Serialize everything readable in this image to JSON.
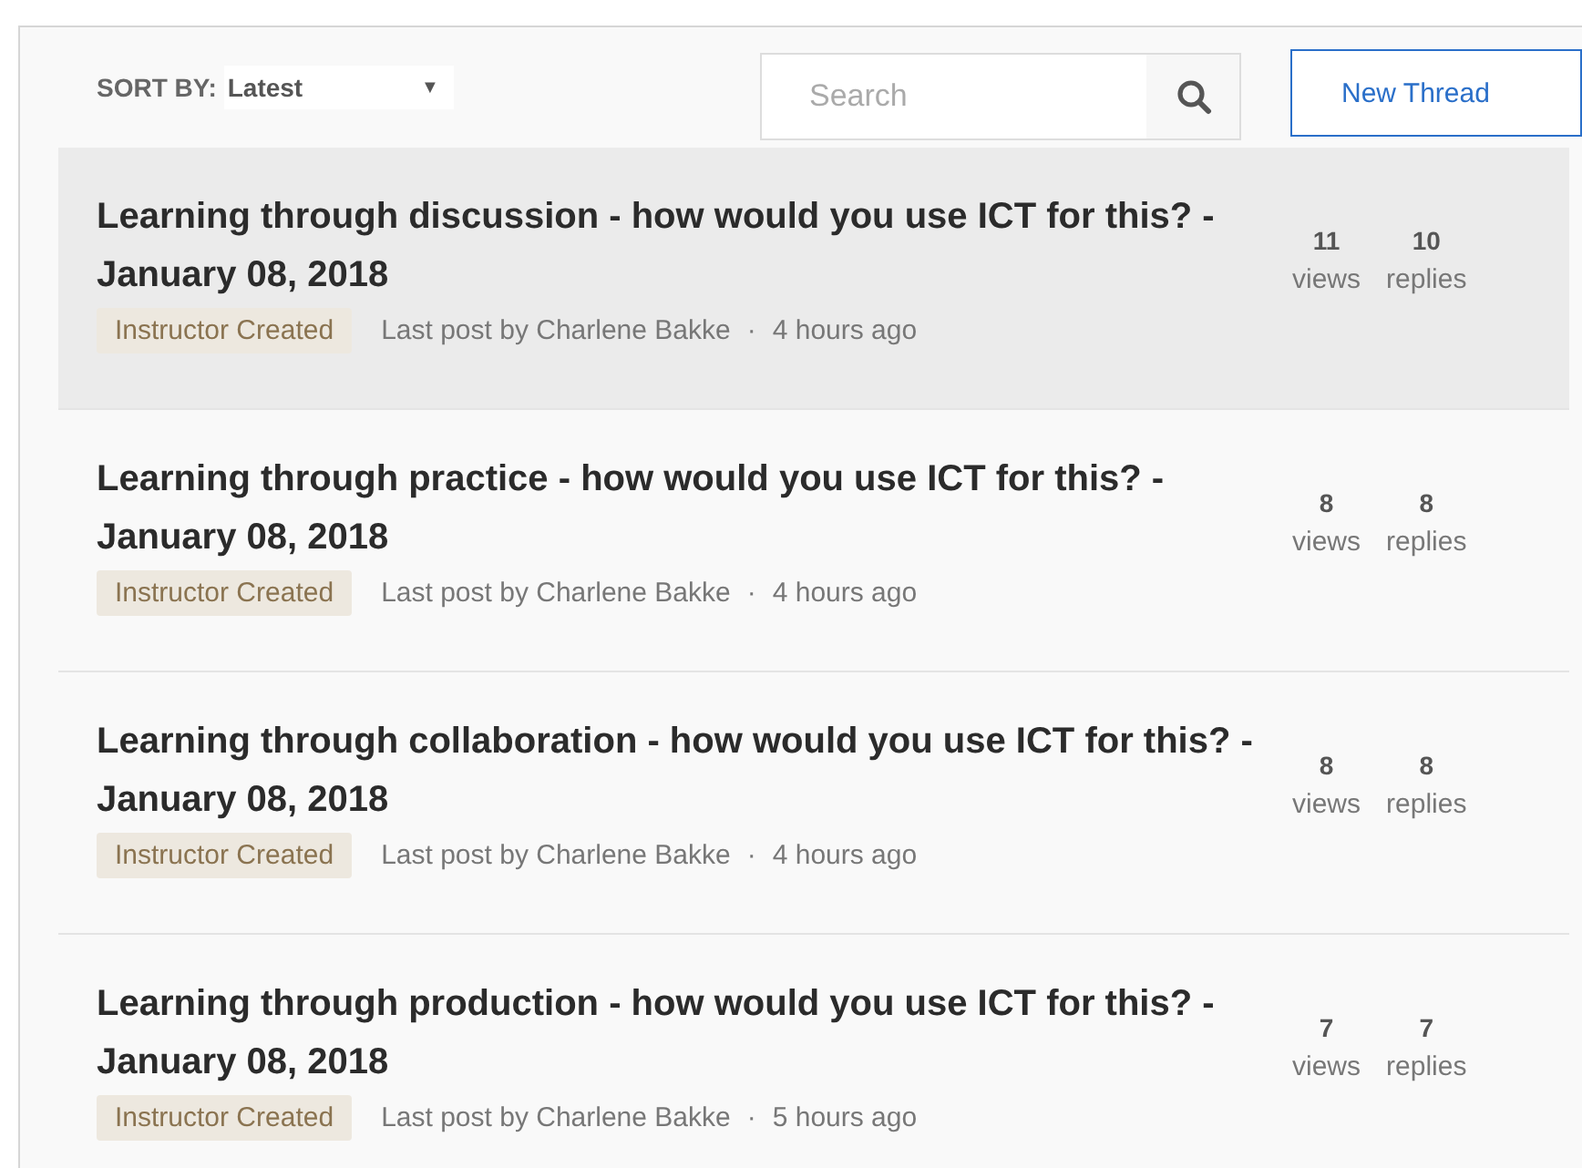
{
  "toolbar": {
    "sort_label": "SORT BY:",
    "sort_value": "Latest",
    "sort_caret": "▼",
    "search": {
      "placeholder": "Search"
    },
    "new_thread_button": "New Thread"
  },
  "threads": [
    {
      "title": "Learning through discussion - how would you use ICT for this? - January 08, 2018",
      "tag": "Instructor Created",
      "last_post": "Last post by Charlene Bakke",
      "separator": "·",
      "time": "4 hours ago",
      "views": "11",
      "views_label": "views",
      "replies": "10",
      "replies_label": "replies",
      "selected": true
    },
    {
      "title": "Learning through practice - how would you use ICT for this? - January 08, 2018",
      "tag": "Instructor Created",
      "last_post": "Last post by Charlene Bakke",
      "separator": "·",
      "time": "4 hours ago",
      "views": "8",
      "views_label": "views",
      "replies": "8",
      "replies_label": "replies",
      "selected": false
    },
    {
      "title": "Learning through collaboration - how would you use ICT for this? - January 08, 2018",
      "tag": "Instructor Created",
      "last_post": "Last post by Charlene Bakke",
      "separator": "·",
      "time": "4 hours ago",
      "views": "8",
      "views_label": "views",
      "replies": "8",
      "replies_label": "replies",
      "selected": false
    },
    {
      "title": "Learning through production - how would you use ICT for this? - January 08, 2018",
      "tag": "Instructor Created",
      "last_post": "Last post by Charlene Bakke",
      "separator": "·",
      "time": "5 hours ago",
      "views": "7",
      "views_label": "views",
      "replies": "7",
      "replies_label": "replies",
      "selected": false
    }
  ]
}
